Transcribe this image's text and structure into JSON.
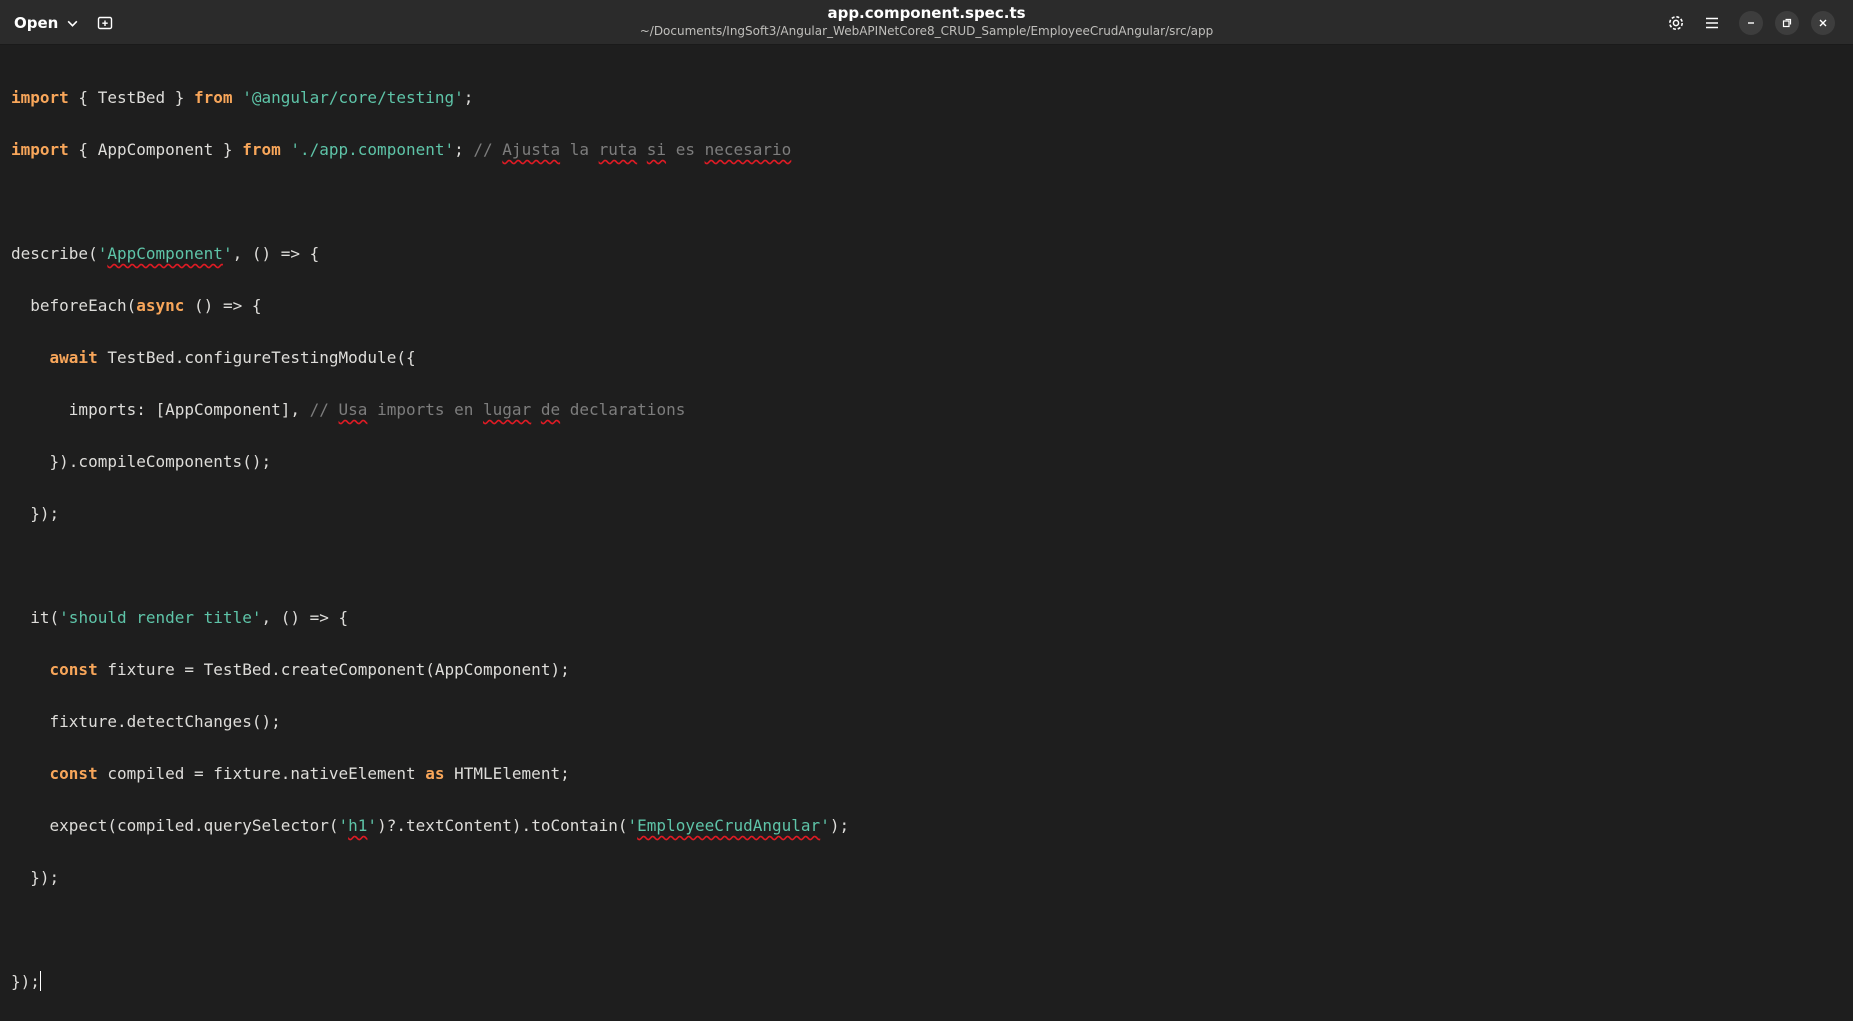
{
  "header": {
    "open_label": "Open",
    "title": "app.component.spec.ts",
    "path": "~/Documents/IngSoft3/Angular_WebAPINetCore8_CRUD_Sample/EmployeeCrudAngular/src/app",
    "icons": [
      "chevron-down-icon",
      "new-tab-icon",
      "settings-icon",
      "hamburger-menu-icon",
      "minimize-icon",
      "restore-icon",
      "close-icon"
    ]
  },
  "code": {
    "l1": {
      "kw1": "import",
      "t1": " { TestBed } ",
      "kw2": "from",
      "t2": " ",
      "s1": "'@angular/core/testing'",
      "t3": ";"
    },
    "l2": {
      "kw1": "import",
      "t1": " { AppComponent } ",
      "kw2": "from",
      "t2": " ",
      "s1": "'./app.component'",
      "t3": "; ",
      "c1": "// ",
      "c2": "Ajusta",
      "c3": " la ",
      "c4": "ruta",
      "c5": " ",
      "c6": "si",
      "c7": " es ",
      "c8": "necesario"
    },
    "l4": {
      "t1": "describe(",
      "s1": "'",
      "s2": "AppComponent",
      "s3": "'",
      "t2": ", () => {"
    },
    "l5": {
      "t1": "  beforeEach(",
      "kw1": "async",
      "t2": " () => {"
    },
    "l6": {
      "t1": "    ",
      "kw1": "await",
      "t2": " TestBed.configureTestingModule({"
    },
    "l7": {
      "t1": "      imports: [AppComponent], ",
      "c1": "// ",
      "c2": "Usa",
      "c3": " imports en ",
      "c4": "lugar",
      "c5": " ",
      "c6": "de",
      "c7": " declarations"
    },
    "l8": {
      "t1": "    }).compileComponents();"
    },
    "l9": {
      "t1": "  });"
    },
    "l11": {
      "t1": "  it(",
      "s1": "'should render title'",
      "t2": ", () => {"
    },
    "l12": {
      "t1": "    ",
      "kw1": "const",
      "t2": " fixture = TestBed.createComponent(AppComponent);"
    },
    "l13": {
      "t1": "    fixture.detectChanges();"
    },
    "l14": {
      "t1": "    ",
      "kw1": "const",
      "t2": " compiled = fixture.nativeElement ",
      "kw2": "as",
      "t3": " HTMLElement;"
    },
    "l15": {
      "t1": "    expect(compiled.querySelector(",
      "s1": "'",
      "s2": "h1",
      "s3": "'",
      "t2": ")?.textContent).toContain(",
      "s4": "'",
      "s5": "EmployeeCrudAngular",
      "s6": "'",
      "t3": ");"
    },
    "l16": {
      "t1": "  });"
    },
    "l18": {
      "t1": "});"
    }
  },
  "colors": {
    "keyword": "#f8a65a",
    "string": "#5ec4a8",
    "comment": "#7d7d7d",
    "text": "#deddda",
    "background": "#1e1e1e",
    "spellcheck": "#e01b24"
  }
}
